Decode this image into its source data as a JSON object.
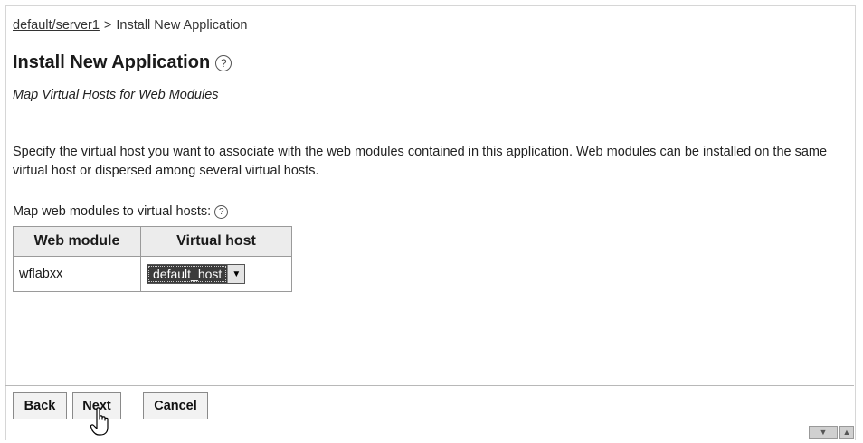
{
  "breadcrumb": {
    "link": "default/server1",
    "separator": ">",
    "current": "Install New Application"
  },
  "page": {
    "title": "Install New Application",
    "subtitle": "Map Virtual Hosts for Web Modules",
    "description": "Specify the virtual host you want to associate with the web modules contained in this application. Web modules can be installed on the same virtual host or dispersed among several virtual hosts.",
    "map_label": "Map web modules to virtual hosts:"
  },
  "help_glyph": "?",
  "table": {
    "headers": [
      "Web module",
      "Virtual host"
    ],
    "rows": [
      {
        "module": "wflabxx",
        "host": "default_host"
      }
    ]
  },
  "buttons": {
    "back": "Back",
    "next": "Next",
    "cancel": "Cancel"
  },
  "icons": {
    "help": "help-icon",
    "dropdown": "chevron-down-icon",
    "cursor": "hand-pointer-icon"
  }
}
